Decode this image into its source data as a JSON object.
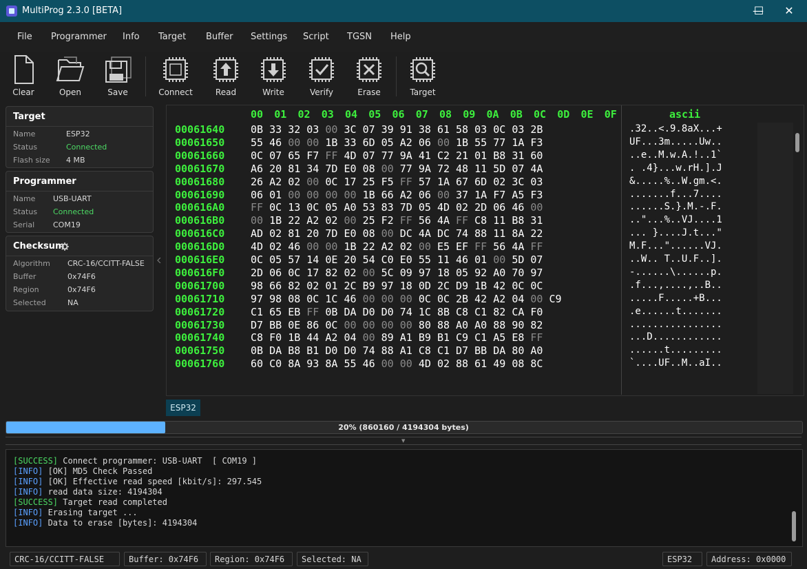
{
  "window": {
    "title": "MultiProg 2.3.0 [BETA]",
    "controls": {
      "minimize": "—",
      "maximize": "☐",
      "close": "✕"
    }
  },
  "menu": [
    "File",
    "Programmer",
    "Info",
    "Target",
    "Buffer",
    "Settings",
    "Script",
    "TGSN",
    "Help"
  ],
  "toolbar": [
    {
      "label": "Clear",
      "icon": "document-icon"
    },
    {
      "label": "Open",
      "icon": "folder-open-icon"
    },
    {
      "label": "Save",
      "icon": "floppy-disk-icon"
    },
    {
      "label": "Connect",
      "icon": "chip-icon"
    },
    {
      "label": "Read",
      "icon": "chip-read-icon"
    },
    {
      "label": "Write",
      "icon": "chip-write-icon"
    },
    {
      "label": "Verify",
      "icon": "chip-verify-icon"
    },
    {
      "label": "Erase",
      "icon": "chip-erase-icon"
    },
    {
      "label": "Target",
      "icon": "chip-search-icon"
    }
  ],
  "target_panel": {
    "title": "Target",
    "rows": [
      {
        "label": "Name",
        "value": "ESP32"
      },
      {
        "label": "Status",
        "value": "Connected"
      },
      {
        "label": "Flash size",
        "value": "4 MB"
      }
    ]
  },
  "programmer_panel": {
    "title": "Programmer",
    "rows": [
      {
        "label": "Name",
        "value": "USB-UART"
      },
      {
        "label": "Status",
        "value": "Connected"
      },
      {
        "label": "Serial",
        "value": "COM19"
      }
    ]
  },
  "checksum_panel": {
    "title": "Checksum",
    "rows": [
      {
        "label": "Algorithm",
        "value": "CRC-16/CCITT-FALSE"
      },
      {
        "label": "Buffer",
        "value": "0x74F6"
      },
      {
        "label": "Region",
        "value": "0x74F6"
      },
      {
        "label": "Selected",
        "value": "NA"
      }
    ]
  },
  "hex_view": {
    "columns": [
      "00",
      "01",
      "02",
      "03",
      "04",
      "05",
      "06",
      "07",
      "08",
      "09",
      "0A",
      "0B",
      "0C",
      "0D",
      "0E",
      "0F"
    ],
    "ascii_title": "ascii",
    "rows": [
      {
        "addr": "00061640",
        "bytes": "0B 33 32 03 00 3C 07 39 91 38 61 58 03 0C 03 2B",
        "ascii": ".32..<.9.8aX...+"
      },
      {
        "addr": "00061650",
        "bytes": "55 46 00 00 1B 33 6D 05 A2 06 00 1B 55 77 1A F3",
        "ascii": "UF...3m.....Uw.."
      },
      {
        "addr": "00061660",
        "bytes": "0C 07 65 F7 FF 4D 07 77 9A 41 C2 21 01 B8 31 60",
        "ascii": "..e..M.w.A.!..1`"
      },
      {
        "addr": "00061670",
        "bytes": "A6 20 81 34 7D E0 08 00 77 9A 72 48 11 5D 07 4A",
        "ascii": ". .4}...w.rH.].J"
      },
      {
        "addr": "00061680",
        "bytes": "26 A2 02 00 0C 17 25 F5 FF 57 1A 67 6D 02 3C 03",
        "ascii": "&.....%..W.gm.<."
      },
      {
        "addr": "00061690",
        "bytes": "06 01 00 00 00 00 1B 66 A2 06 00 37 1A F7 A5 F3",
        "ascii": ".......f...7...."
      },
      {
        "addr": "000616A0",
        "bytes": "FF 0C 13 0C 05 A0 53 83 7D 05 4D 02 2D 06 46 00",
        "ascii": "......S.}.M.-.F."
      },
      {
        "addr": "000616B0",
        "bytes": "00 1B 22 A2 02 00 25 F2 FF 56 4A FF C8 11 B8 31",
        "ascii": "..\"...%..VJ....1"
      },
      {
        "addr": "000616C0",
        "bytes": "AD 02 81 20 7D E0 08 00 DC 4A DC 74 88 11 8A 22",
        "ascii": "... }....J.t...\""
      },
      {
        "addr": "000616D0",
        "bytes": "4D 02 46 00 00 1B 22 A2 02 00 E5 EF FF 56 4A FF",
        "ascii": "M.F...\"......VJ."
      },
      {
        "addr": "000616E0",
        "bytes": "0C 05 57 14 0E 20 54 C0 E0 55 11 46 01 00 5D 07",
        "ascii": "..W.. T..U.F..]."
      },
      {
        "addr": "000616F0",
        "bytes": "2D 06 0C 17 82 02 00 5C 09 97 18 05 92 A0 70 97",
        "ascii": "-......\\......p."
      },
      {
        "addr": "00061700",
        "bytes": "98 66 82 02 01 2C B9 97 18 0D 2C D9 1B 42 0C 0C",
        "ascii": ".f...,....,..B.."
      },
      {
        "addr": "00061710",
        "bytes": "97 98 08 0C 1C 46 00 00 00 0C 0C 2B 42 A2 04 00 C9",
        "ascii": ".....F.....+B..."
      },
      {
        "addr": "00061720",
        "bytes": "C1 65 EB FF 0B DA D0 D0 74 1C 8B C8 C1 82 CA F0",
        "ascii": ".e......t......."
      },
      {
        "addr": "00061730",
        "bytes": "D7 BB 0E 86 0C 00 00 00 00 80 88 A0 A0 88 90 82",
        "ascii": "................"
      },
      {
        "addr": "00061740",
        "bytes": "C8 F0 1B 44 A2 04 00 89 A1 B9 B1 C9 C1 A5 E8 FF",
        "ascii": "...D............"
      },
      {
        "addr": "00061750",
        "bytes": "0B DA B8 B1 D0 D0 74 88 A1 C8 C1 D7 BB DA 80 A0",
        "ascii": "......t........."
      },
      {
        "addr": "00061760",
        "bytes": "60 C0 8A 93 8A 55 46 00 00 4D 02 88 61 49 08 8C",
        "ascii": "`....UF..M..aI.."
      }
    ]
  },
  "buffer_tab": "ESP32",
  "progress": {
    "fraction": 0.2,
    "text": "20%  (860160 / 4194304 bytes)"
  },
  "log": [
    {
      "tag": "[SUCCESS]",
      "kind": "success",
      "text": " Connect programmer: USB-UART  [ COM19 ]"
    },
    {
      "tag": "[INFO]",
      "kind": "info",
      "text": " [OK] MD5 Check Passed"
    },
    {
      "tag": "[INFO]",
      "kind": "info",
      "text": " [OK] Effective read speed [kbit/s]: 297.545"
    },
    {
      "tag": "[INFO]",
      "kind": "info",
      "text": " read data size: 4194304"
    },
    {
      "tag": "[SUCCESS]",
      "kind": "success",
      "text": " Target read completed"
    },
    {
      "tag": "[INFO]",
      "kind": "info",
      "text": " Erasing target ..."
    },
    {
      "tag": "[INFO]",
      "kind": "info",
      "text": " Data to erase [bytes]: 4194304"
    }
  ],
  "statusbar": {
    "algorithm": "CRC-16/CCITT-FALSE",
    "buffer": "Buffer: 0x74F6",
    "region": "Region: 0x74F6",
    "selected": "Selected: NA",
    "target": "ESP32",
    "address": "Address: 0x0000"
  },
  "colors": {
    "accent": "#0d4f63",
    "hex_green": "#3df03d",
    "progress": "#5db2ff"
  }
}
